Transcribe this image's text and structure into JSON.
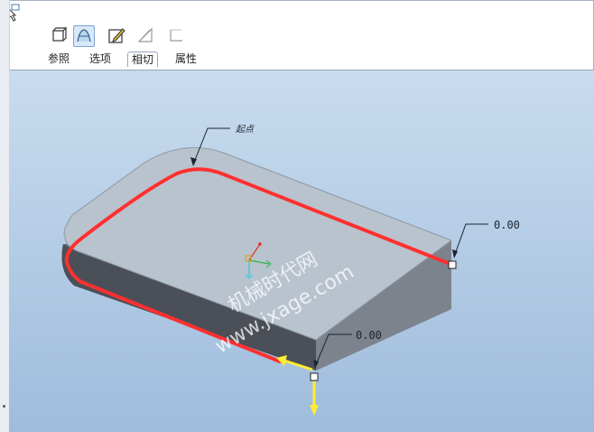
{
  "toolbar": {
    "tabs": [
      {
        "label": "参照"
      },
      {
        "label": "选项"
      },
      {
        "label": "相切",
        "selected": true
      },
      {
        "label": "属性"
      }
    ]
  },
  "viewport": {
    "start_point_label": "起点",
    "dimension_top": "0.00",
    "dimension_bottom": "0.00",
    "watermark_line1": "机械时代网",
    "watermark_line2": "www.jxage.com"
  },
  "colors": {
    "highlight_edge": "#ff3030",
    "arrow": "#ffee33"
  },
  "icons": [
    "pointer-icon",
    "solid-box-icon",
    "surface-icon",
    "sketch-edit-icon",
    "construction-icon",
    "boundary-icon"
  ]
}
